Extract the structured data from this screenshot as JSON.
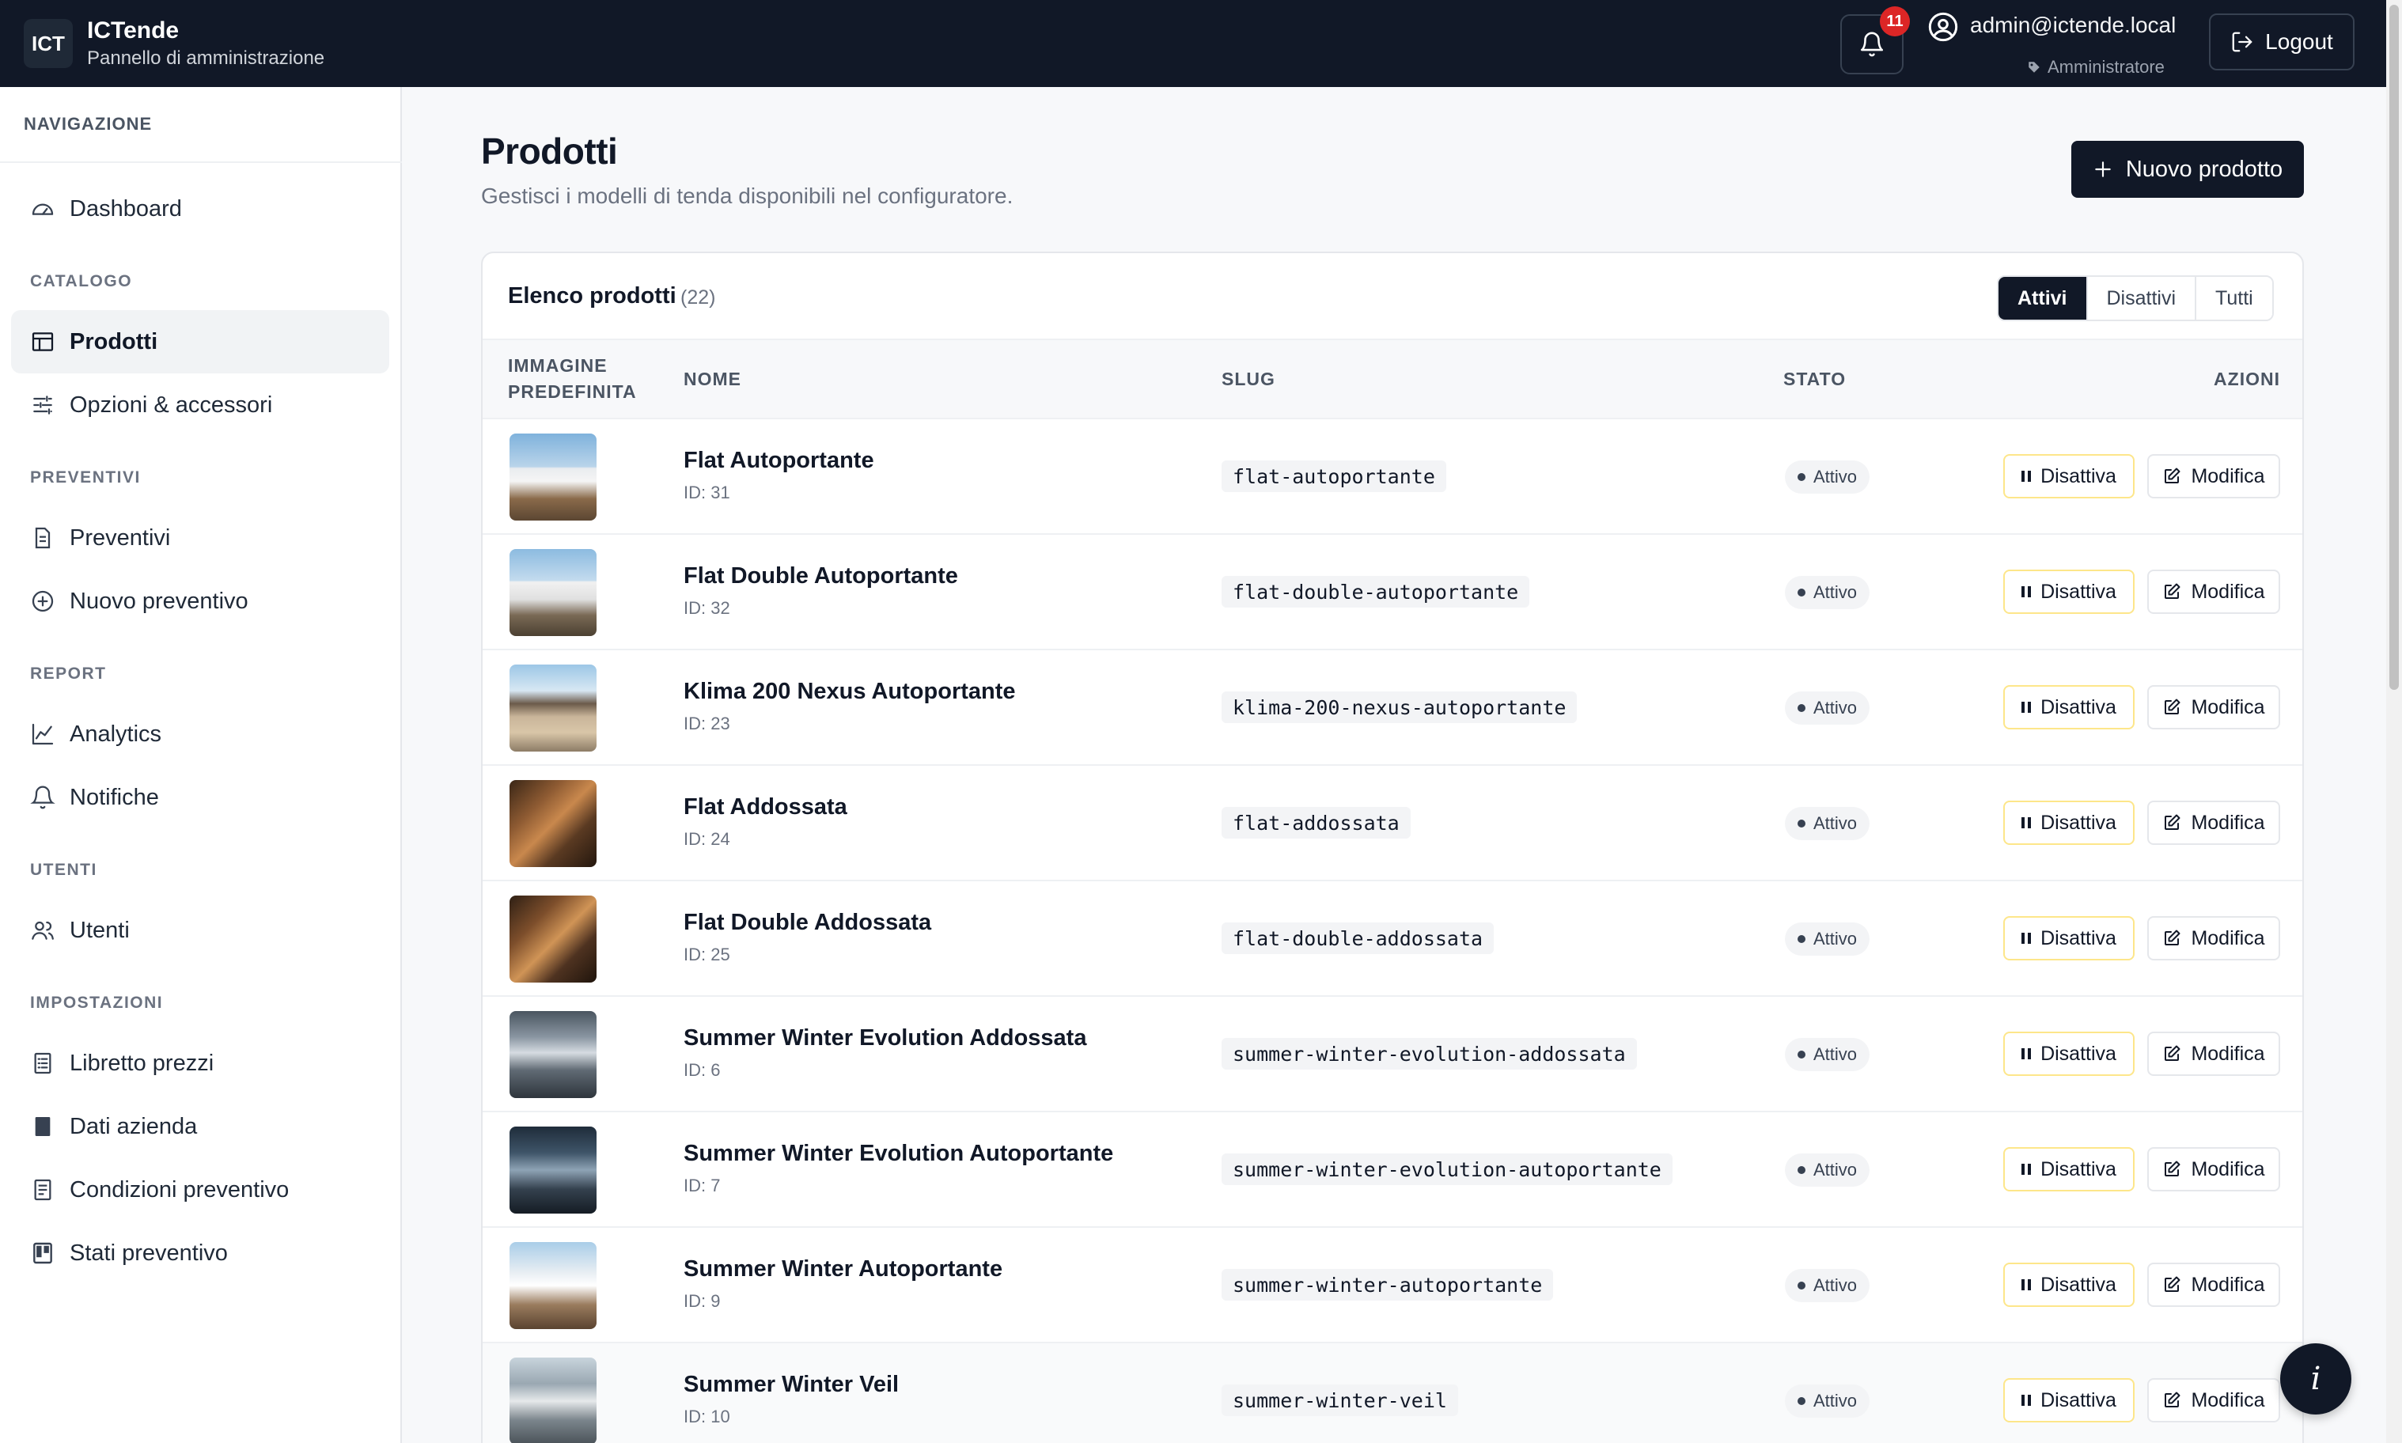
{
  "app": {
    "logo": "ICT",
    "title": "ICTende",
    "subtitle": "Pannello di amministrazione"
  },
  "header": {
    "notifications_count": "11",
    "user_email": "admin@ictende.local",
    "user_role": "Amministratore",
    "logout_label": "Logout"
  },
  "sidebar": {
    "heading": "NAVIGAZIONE",
    "dashboard": "Dashboard",
    "sections": {
      "catalogo": "CATALOGO",
      "preventivi": "PREVENTIVI",
      "report": "REPORT",
      "utenti": "UTENTI",
      "impostazioni": "IMPOSTAZIONI"
    },
    "items": {
      "prodotti": "Prodotti",
      "opzioni": "Opzioni & accessori",
      "preventivi": "Preventivi",
      "nuovo_preventivo": "Nuovo preventivo",
      "analytics": "Analytics",
      "notifiche": "Notifiche",
      "utenti": "Utenti",
      "libretto_prezzi": "Libretto prezzi",
      "dati_azienda": "Dati azienda",
      "condizioni_preventivo": "Condizioni preventivo",
      "stati_preventivo": "Stati preventivo"
    }
  },
  "main": {
    "title": "Prodotti",
    "subtitle": "Gestisci i modelli di tenda disponibili nel configuratore.",
    "new_button": "Nuovo prodotto",
    "list_title": "Elenco prodotti",
    "list_count": "(22)",
    "filters": [
      "Attivi",
      "Disattivi",
      "Tutti"
    ],
    "active_filter": "Attivi",
    "columns": {
      "image_line1": "IMMAGINE",
      "image_line2": "PREDEFINITA",
      "name": "NOME",
      "slug": "SLUG",
      "status": "STATO",
      "actions": "AZIONI"
    },
    "deactivate_label": "Disattiva",
    "edit_label": "Modifica",
    "products": [
      {
        "name": "Flat Autoportante",
        "id": "ID: 31",
        "slug": "flat-autoportante",
        "status": "Attivo"
      },
      {
        "name": "Flat Double Autoportante",
        "id": "ID: 32",
        "slug": "flat-double-autoportante",
        "status": "Attivo"
      },
      {
        "name": "Klima 200 Nexus Autoportante",
        "id": "ID: 23",
        "slug": "klima-200-nexus-autoportante",
        "status": "Attivo"
      },
      {
        "name": "Flat Addossata",
        "id": "ID: 24",
        "slug": "flat-addossata",
        "status": "Attivo"
      },
      {
        "name": "Flat Double Addossata",
        "id": "ID: 25",
        "slug": "flat-double-addossata",
        "status": "Attivo"
      },
      {
        "name": "Summer Winter Evolution Addossata",
        "id": "ID: 6",
        "slug": "summer-winter-evolution-addossata",
        "status": "Attivo"
      },
      {
        "name": "Summer Winter Evolution Autoportante",
        "id": "ID: 7",
        "slug": "summer-winter-evolution-autoportante",
        "status": "Attivo"
      },
      {
        "name": "Summer Winter Autoportante",
        "id": "ID: 9",
        "slug": "summer-winter-autoportante",
        "status": "Attivo"
      },
      {
        "name": "Summer Winter Veil",
        "id": "ID: 10",
        "slug": "summer-winter-veil",
        "status": "Attivo"
      }
    ],
    "info_button": "i"
  }
}
